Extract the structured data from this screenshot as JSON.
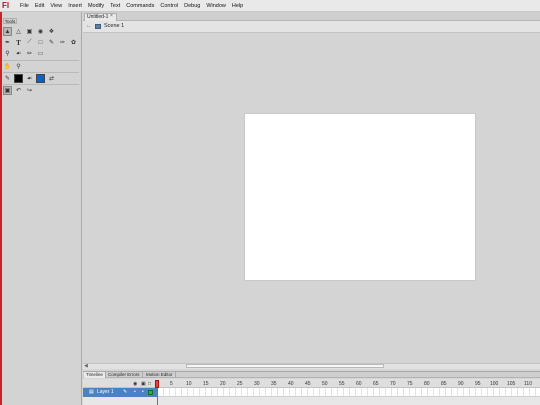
{
  "app": {
    "logo": "Fl"
  },
  "menu": [
    "File",
    "Edit",
    "View",
    "Insert",
    "Modify",
    "Text",
    "Commands",
    "Control",
    "Debug",
    "Window",
    "Help"
  ],
  "tools_panel": {
    "tab_label": "Tools"
  },
  "document": {
    "tab_label": "Untitled-1",
    "close_glyph": "×"
  },
  "scene": {
    "label": "Scene 1"
  },
  "timeline": {
    "tabs": [
      "Timeline",
      "Compiler Errors",
      "Motion Editor"
    ],
    "frame_numbers": [
      "5",
      "10",
      "15",
      "20",
      "25",
      "30",
      "35",
      "40",
      "45",
      "50",
      "55",
      "60",
      "65",
      "70",
      "75",
      "80",
      "85",
      "90",
      "95",
      "100",
      "105",
      "110"
    ],
    "layer": {
      "name": "Layer 1"
    }
  },
  "colors": {
    "accent": "#b1182a",
    "layer_selected": "#4b82c2",
    "playhead": "#e04545",
    "fill_swatch": "#0b62c4",
    "stroke_swatch": "#000000"
  }
}
